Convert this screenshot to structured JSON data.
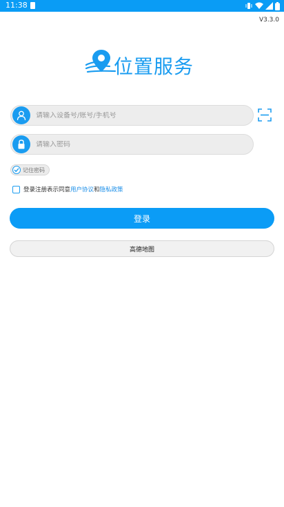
{
  "status_bar": {
    "time": "11:38",
    "bg_color": "#0a9cf5",
    "icons": [
      "notification-icon",
      "vibrate-icon",
      "wifi-icon",
      "signal-icon",
      "battery-icon"
    ]
  },
  "version": "V3.3.0",
  "logo": {
    "text": "位置服务",
    "icon": "map-pin-logo-icon",
    "color": "#1a9cf0"
  },
  "account": {
    "placeholder": "请输入设备号/账号/手机号",
    "icon": "user-icon"
  },
  "password": {
    "placeholder": "请输入密码",
    "icon": "lock-icon"
  },
  "scan": {
    "icon": "scan-icon"
  },
  "remember": {
    "label": "记住密码",
    "checked": true
  },
  "agreement": {
    "prefix": "登录注册表示同意",
    "user_agreement": "用户协议",
    "and": "和",
    "privacy_policy": "隐私政策",
    "checked": false
  },
  "login_button": {
    "label": "登录"
  },
  "map_button": {
    "label": "高德地图"
  },
  "colors": {
    "accent": "#0b9cf6",
    "link": "#1a8ee8"
  }
}
